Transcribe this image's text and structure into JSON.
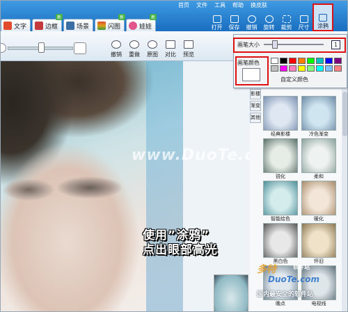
{
  "menu": [
    "首页",
    "文件",
    "工具",
    "帮助",
    "换皮肤"
  ],
  "tabs": [
    {
      "label": "文字",
      "color": "#e24b2b",
      "badge": ""
    },
    {
      "label": "边框",
      "color": "#c43a3a",
      "badge": "新"
    },
    {
      "label": "场景",
      "color": "#3a6ea5",
      "badge": ""
    },
    {
      "label": "闪图",
      "color": "#d9a21a",
      "badge": "新"
    },
    {
      "label": "娃娃",
      "color": "#e0558a",
      "badge": "新"
    }
  ],
  "tools": [
    "打开",
    "保存",
    "撤销",
    "旋转",
    "裁剪",
    "尺寸",
    "涂鸦"
  ],
  "edit_buttons": [
    "撤销",
    "重做",
    "原图",
    "对比",
    "预览"
  ],
  "brush_popup": {
    "size_label": "画笔大小",
    "size_value": "1",
    "color_label": "画笔颜色",
    "custom_color_label": "自定义颜色",
    "palette": [
      "#ffffff",
      "#000000",
      "#ff0000",
      "#ff8000",
      "#00ff00",
      "#00c0c0",
      "#0000ff",
      "#800080",
      "#c0c0c0",
      "#ff00ff",
      "#ff80c0",
      "#ffff00",
      "#80ff80",
      "#00ffff",
      "#80c0ff",
      "#ff8080"
    ]
  },
  "side_tabs": [
    "影楼",
    "渐变",
    "其他"
  ],
  "effects": [
    {
      "label": "经典影楼",
      "c1": "#dfe8f2",
      "c2": "#7a8fb0"
    },
    {
      "label": "冷色渐变",
      "c1": "#cfe5f0",
      "c2": "#6c8aa6"
    },
    {
      "label": "锐化",
      "c1": "#e6ece6",
      "c2": "#5a7068"
    },
    {
      "label": "柔和",
      "c1": "#eef2f0",
      "c2": "#8aa09a"
    },
    {
      "label": "智能绘色",
      "c1": "#d5ecec",
      "c2": "#4c8f9a"
    },
    {
      "label": "暖化",
      "c1": "#f2e6d8",
      "c2": "#a88a6a"
    },
    {
      "label": "黑白色",
      "c1": "#e8e8e8",
      "c2": "#555555"
    },
    {
      "label": "怀旧",
      "c1": "#efe2c8",
      "c2": "#8a7550"
    },
    {
      "label": "晚点",
      "c1": "#e0e8ee",
      "c2": "#6a7c8a"
    },
    {
      "label": "电视线",
      "c1": "#dfe6ea",
      "c2": "#5f6f7a"
    }
  ],
  "annotation": {
    "line1": "使用”涂鸦”",
    "line2": "点出眼部高光"
  },
  "watermark": "www.DuoTe.com",
  "site_logo": {
    "cn": "多特",
    "mid": "软件站",
    "en": "DuoTe.com",
    "slogan": "国内最安全的软件站"
  }
}
